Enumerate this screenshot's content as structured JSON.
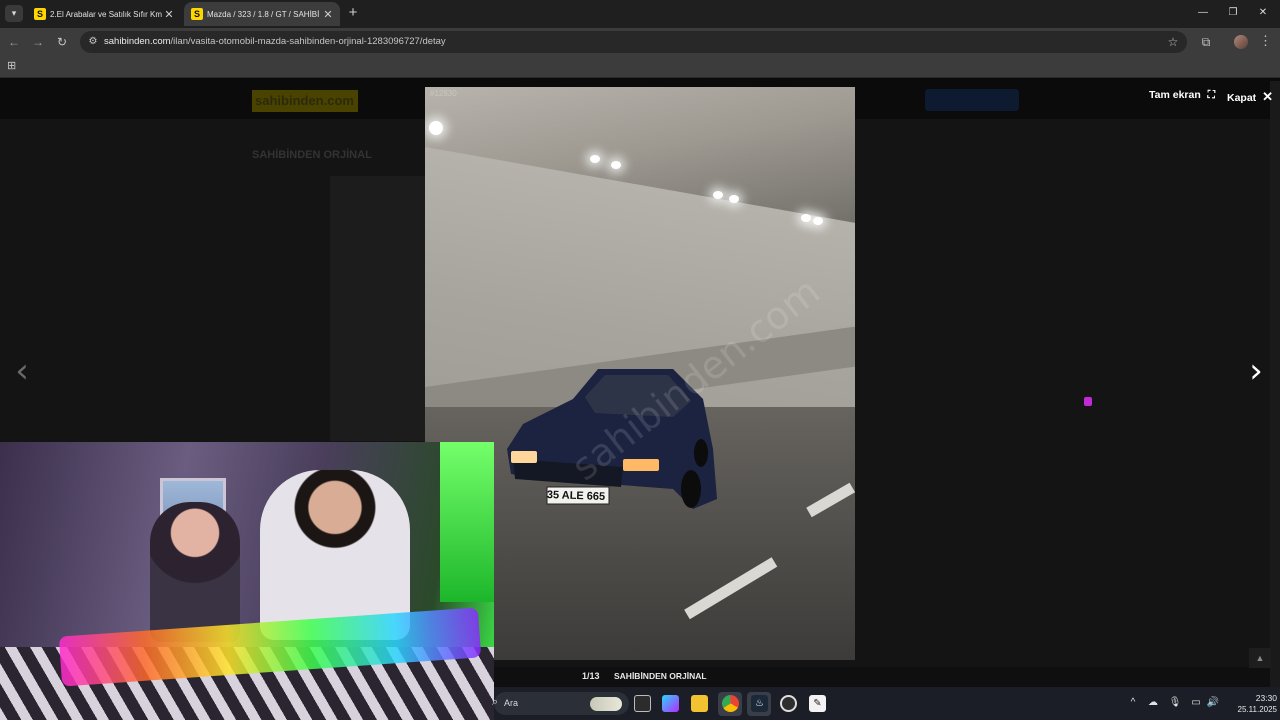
{
  "browser": {
    "tabs": [
      {
        "title": "2.El Arabalar ve Satılık Sıfır Km",
        "active": false
      },
      {
        "title": "Mazda / 323 / 1.8 / GT / SAHİBİ",
        "active": true
      }
    ],
    "favicon_letter": "S",
    "close_glyph": "✕",
    "new_tab_glyph": "+",
    "url_domain": "sahibinden.com",
    "url_path": "/ilan/vasita-otomobil-mazda-sahibinden-orjinal-1283096727/detay"
  },
  "page_behind": {
    "logo_text": "sahibinden.com",
    "heading": "SAHİBİNDEN ORJİNAL"
  },
  "lightbox": {
    "photo_id": "#12830",
    "watermark": "sahibinden.com",
    "fullscreen_label": "Tam ekran",
    "close_label": "Kapat",
    "counter": "1/13",
    "caption": "SAHİBİNDEN ORJİNAL",
    "license_plate": "35 ALE 665"
  },
  "taskbar": {
    "search_placeholder": "Ara",
    "time": "23:30",
    "date": "25.11.2025"
  },
  "colors": {
    "brand_yellow": "#ffd600",
    "chrome_dark": "#1f1f1f",
    "toolbar": "#3c3c3c",
    "taskbar": "#1b1e26"
  }
}
